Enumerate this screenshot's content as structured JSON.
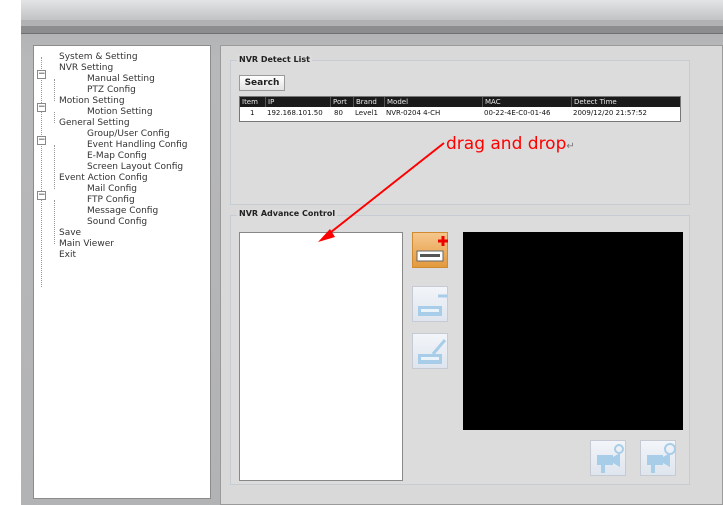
{
  "tree": {
    "items": [
      {
        "label": "System & Setting"
      },
      {
        "label": "NVR  Setting"
      },
      {
        "label": "Manual Setting"
      },
      {
        "label": "PTZ Config"
      },
      {
        "label": "Motion Setting"
      },
      {
        "label": "Motion Setting"
      },
      {
        "label": "General Setting"
      },
      {
        "label": "Group/User Config"
      },
      {
        "label": "Event Handling Config"
      },
      {
        "label": "E-Map Config"
      },
      {
        "label": "Screen Layout Config"
      },
      {
        "label": "Event Action Config"
      },
      {
        "label": "Mail Config"
      },
      {
        "label": "FTP Config"
      },
      {
        "label": "Message Config"
      },
      {
        "label": "Sound Config"
      },
      {
        "label": "Save"
      },
      {
        "label": "Main Viewer"
      },
      {
        "label": "Exit"
      }
    ],
    "toggle_symbol": "−"
  },
  "detect": {
    "title": "NVR  Detect List",
    "search_label": "Search",
    "columns": [
      "Item",
      "IP",
      "Port",
      "Brand",
      "Model",
      "MAC",
      "Detect Time"
    ],
    "rows": [
      [
        "1",
        "192.168.101.50",
        "80",
        "Level1",
        "NVR-0204  4-CH",
        "00-22-4E-C0-01-46",
        "2009/12/20 21:57:52"
      ]
    ]
  },
  "annotation": {
    "text": "drag and drop",
    "return_mark": "↵",
    "color": "#ff0000"
  },
  "advance": {
    "title": "NVR  Advance Control"
  },
  "icons": {
    "add": "add-device-icon",
    "remove": "remove-device-icon",
    "edit": "edit-device-icon",
    "cam_refresh": "camera-refresh-icon",
    "cam_settings": "camera-settings-icon"
  }
}
